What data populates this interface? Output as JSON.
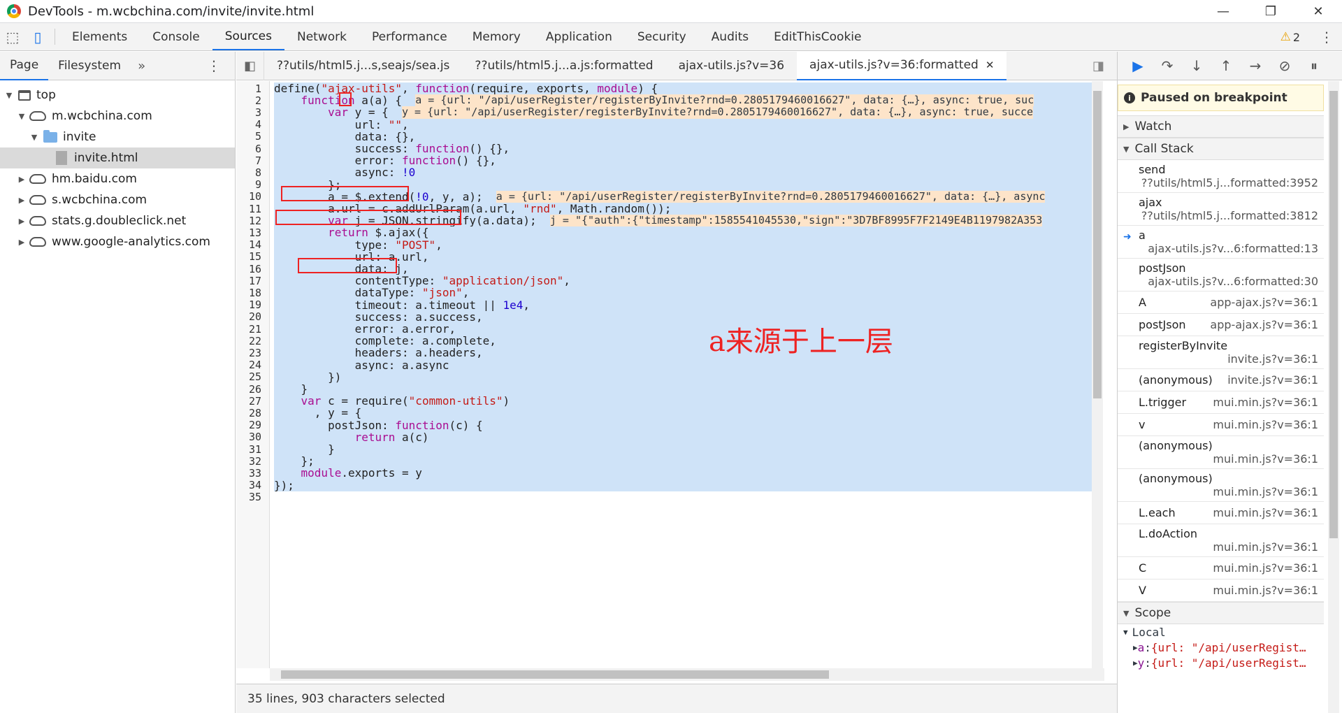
{
  "window": {
    "title": "DevTools - m.wcbchina.com/invite/invite.html",
    "minimize": "—",
    "maximize": "❐",
    "close": "✕"
  },
  "toolbar": {
    "tabs": [
      "Elements",
      "Console",
      "Sources",
      "Network",
      "Performance",
      "Memory",
      "Application",
      "Security",
      "Audits",
      "EditThisCookie"
    ],
    "active_tab": "Sources",
    "warnings_count": "2"
  },
  "navigator": {
    "tabs": [
      "Page",
      "Filesystem"
    ],
    "more": "»",
    "tree": [
      {
        "label": "top",
        "level": 0,
        "icon": "frame",
        "arrow": "▼"
      },
      {
        "label": "m.wcbchina.com",
        "level": 1,
        "icon": "cloud",
        "arrow": "▼"
      },
      {
        "label": "invite",
        "level": 2,
        "icon": "folder",
        "arrow": "▼"
      },
      {
        "label": "invite.html",
        "level": 3,
        "icon": "file",
        "arrow": "",
        "selected": true
      },
      {
        "label": "hm.baidu.com",
        "level": 1,
        "icon": "cloud",
        "arrow": "▶"
      },
      {
        "label": "s.wcbchina.com",
        "level": 1,
        "icon": "cloud",
        "arrow": "▶"
      },
      {
        "label": "stats.g.doubleclick.net",
        "level": 1,
        "icon": "cloud",
        "arrow": "▶"
      },
      {
        "label": "www.google-analytics.com",
        "level": 1,
        "icon": "cloud",
        "arrow": "▶"
      }
    ]
  },
  "editor": {
    "file_tabs": [
      "??utils/html5.j...s,seajs/sea.js",
      "??utils/html5.j...a.js:formatted",
      "ajax-utils.js?v=36",
      "ajax-utils.js?v=36:formatted"
    ],
    "active_file_tab": 3,
    "status": "35 lines, 903 characters selected",
    "annotation": "a来源于上一层",
    "lines": [
      "define(\"ajax-utils\", function(require, exports, module) {",
      "    function a(a) {",
      "        var y = {",
      "            url: \"\",",
      "            data: {},",
      "            success: function() {},",
      "            error: function() {},",
      "            async: !0",
      "        };",
      "        a = $.extend(!0, y, a);",
      "        a.url = c.addUrlParam(a.url, \"rnd\", Math.random());",
      "        var j = JSON.stringify(a.data);",
      "        return $.ajax({",
      "            type: \"POST\",",
      "            url: a.url,",
      "            data: j,",
      "            contentType: \"application/json\",",
      "            dataType: \"json\",",
      "            timeout: a.timeout || 1e4,",
      "            success: a.success,",
      "            error: a.error,",
      "            complete: a.complete,",
      "            headers: a.headers,",
      "            async: a.async",
      "        })",
      "    }",
      "    var c = require(\"common-utils\")",
      "      , y = {",
      "        postJson: function(c) {",
      "            return a(c)",
      "        }",
      "    };",
      "    module.exports = y",
      "});",
      ""
    ],
    "inline_values": [
      {
        "line": 2,
        "text": "a = {url: \"/api/userRegister/registerByInvite?rnd=0.2805179460016627\", data: {…}, async: true, suc"
      },
      {
        "line": 3,
        "text": "y = {url: \"/api/userRegister/registerByInvite?rnd=0.2805179460016627\", data: {…}, async: true, succe"
      },
      {
        "line": 10,
        "text": "a = {url: \"/api/userRegister/registerByInvite?rnd=0.2805179460016627\", data: {…}, async"
      },
      {
        "line": 12,
        "text": "j = \"{\"auth\":{\"timestamp\":1585541045530,\"sign\":\"3D7BF8995F7F2149E4B1197982A353"
      }
    ]
  },
  "debugger": {
    "paused_message": "Paused on breakpoint",
    "watch_label": "Watch",
    "callstack_label": "Call Stack",
    "scope_label": "Scope",
    "local_label": "Local",
    "frames": [
      {
        "name": "send",
        "loc": "??utils/html5.j...formatted:3952",
        "two_line": true
      },
      {
        "name": "ajax",
        "loc": "??utils/html5.j...formatted:3812",
        "two_line": true
      },
      {
        "name": "a",
        "loc": "ajax-utils.js?v...6:formatted:13",
        "two_line": true,
        "current": true
      },
      {
        "name": "postJson",
        "loc": "ajax-utils.js?v...6:formatted:30",
        "two_line": true
      },
      {
        "name": "A",
        "loc": "app-ajax.js?v=36:1",
        "two_line": false
      },
      {
        "name": "postJson",
        "loc": "app-ajax.js?v=36:1",
        "two_line": false
      },
      {
        "name": "registerByInvite",
        "loc": "invite.js?v=36:1",
        "two_line": true
      },
      {
        "name": "(anonymous)",
        "loc": "invite.js?v=36:1",
        "two_line": false
      },
      {
        "name": "L.trigger",
        "loc": "mui.min.js?v=36:1",
        "two_line": false
      },
      {
        "name": "v",
        "loc": "mui.min.js?v=36:1",
        "two_line": false
      },
      {
        "name": "(anonymous)",
        "loc": "mui.min.js?v=36:1",
        "two_line": true
      },
      {
        "name": "(anonymous)",
        "loc": "mui.min.js?v=36:1",
        "two_line": true
      },
      {
        "name": "L.each",
        "loc": "mui.min.js?v=36:1",
        "two_line": false
      },
      {
        "name": "L.doAction",
        "loc": "mui.min.js?v=36:1",
        "two_line": true
      },
      {
        "name": "C",
        "loc": "mui.min.js?v=36:1",
        "two_line": false
      },
      {
        "name": "V",
        "loc": "mui.min.js?v=36:1",
        "two_line": false
      }
    ],
    "scope_rows": [
      {
        "key": "a",
        "value": "{url: \"/api/userRegist…"
      },
      {
        "key": "y",
        "value": "{url: \"/api/userRegist…"
      }
    ]
  },
  "colors": {
    "accent": "#1a73e8",
    "selection": "#cfe3f8",
    "annotation": "#ee2222",
    "inline_value_bg": "#fde4c9"
  }
}
